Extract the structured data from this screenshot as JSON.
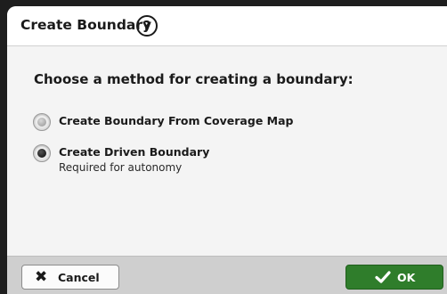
{
  "dialog": {
    "title": "Create Boundary",
    "help_icon": "help-icon",
    "help_glyph": "?",
    "prompt": "Choose a method for creating a boundary:",
    "options": [
      {
        "label": "Create Boundary From Coverage Map",
        "sublabel": "",
        "selected": false
      },
      {
        "label": "Create Driven Boundary",
        "sublabel": "Required for autonomy",
        "selected": true
      }
    ]
  },
  "footer": {
    "cancel_label": "Cancel",
    "cancel_icon": "close-icon",
    "cancel_glyph": "✖",
    "ok_label": "OK",
    "ok_icon": "check-icon"
  },
  "colors": {
    "ok_button": "#2f7d2b",
    "background": "#f4f4f4",
    "footer": "#cfcfcf"
  }
}
